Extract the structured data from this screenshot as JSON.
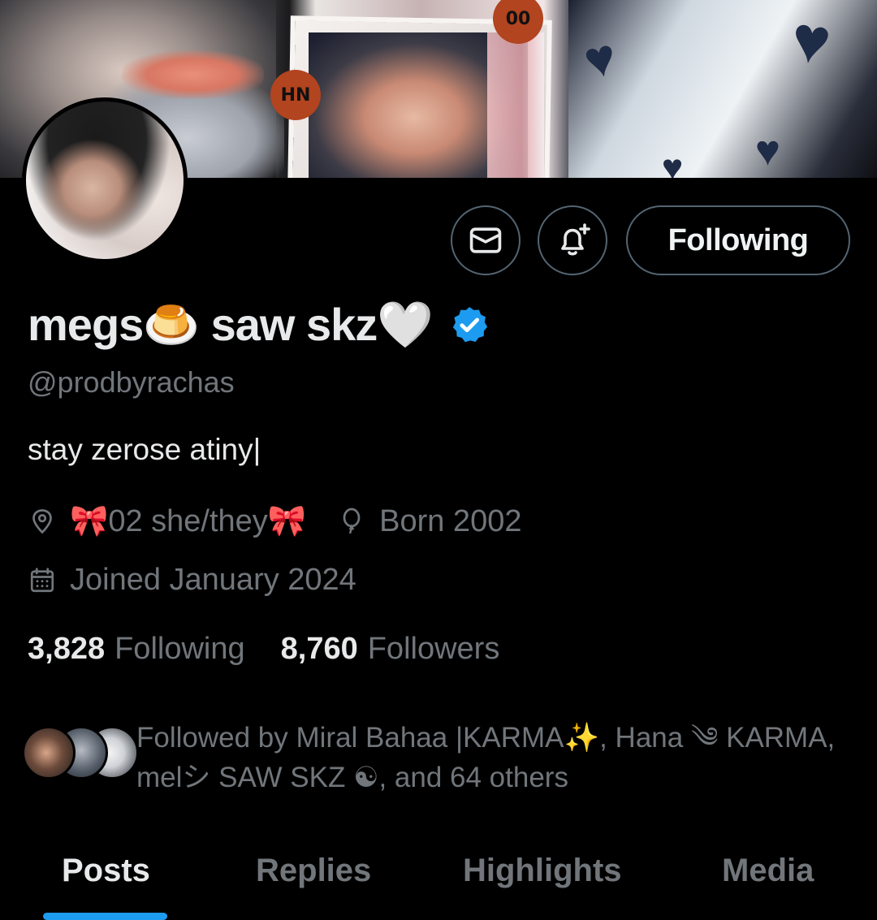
{
  "profile": {
    "display_name": "megs🍮 saw skz🤍",
    "handle": "@prodbyrachas",
    "bio": "stay zerose atiny|",
    "location": "🎀02 she/they🎀",
    "birthday": "Born 2002",
    "joined": "Joined January 2024",
    "verified_color": "#1d9bf0"
  },
  "banner": {
    "stickers": [
      "HN",
      "00"
    ]
  },
  "actions": {
    "message_icon": "envelope-icon",
    "notify_icon": "bell-plus-icon",
    "follow_label": "Following"
  },
  "stats": {
    "following_count": "3,828",
    "following_label": "Following",
    "followers_count": "8,760",
    "followers_label": "Followers"
  },
  "followed_by": {
    "text": "Followed by Miral Bahaa |KARMA✨, Hana ༄ KARMA, melシ SAW SKZ ☯, and 64 others"
  },
  "tabs": [
    {
      "label": "Posts",
      "active": true
    },
    {
      "label": "Replies",
      "active": false
    },
    {
      "label": "Highlights",
      "active": false
    },
    {
      "label": "Media",
      "active": false
    }
  ],
  "colors": {
    "background": "#000000",
    "text_primary": "#e7e9ea",
    "text_secondary": "#71767b",
    "accent": "#1d9bf0",
    "border": "#536471"
  }
}
